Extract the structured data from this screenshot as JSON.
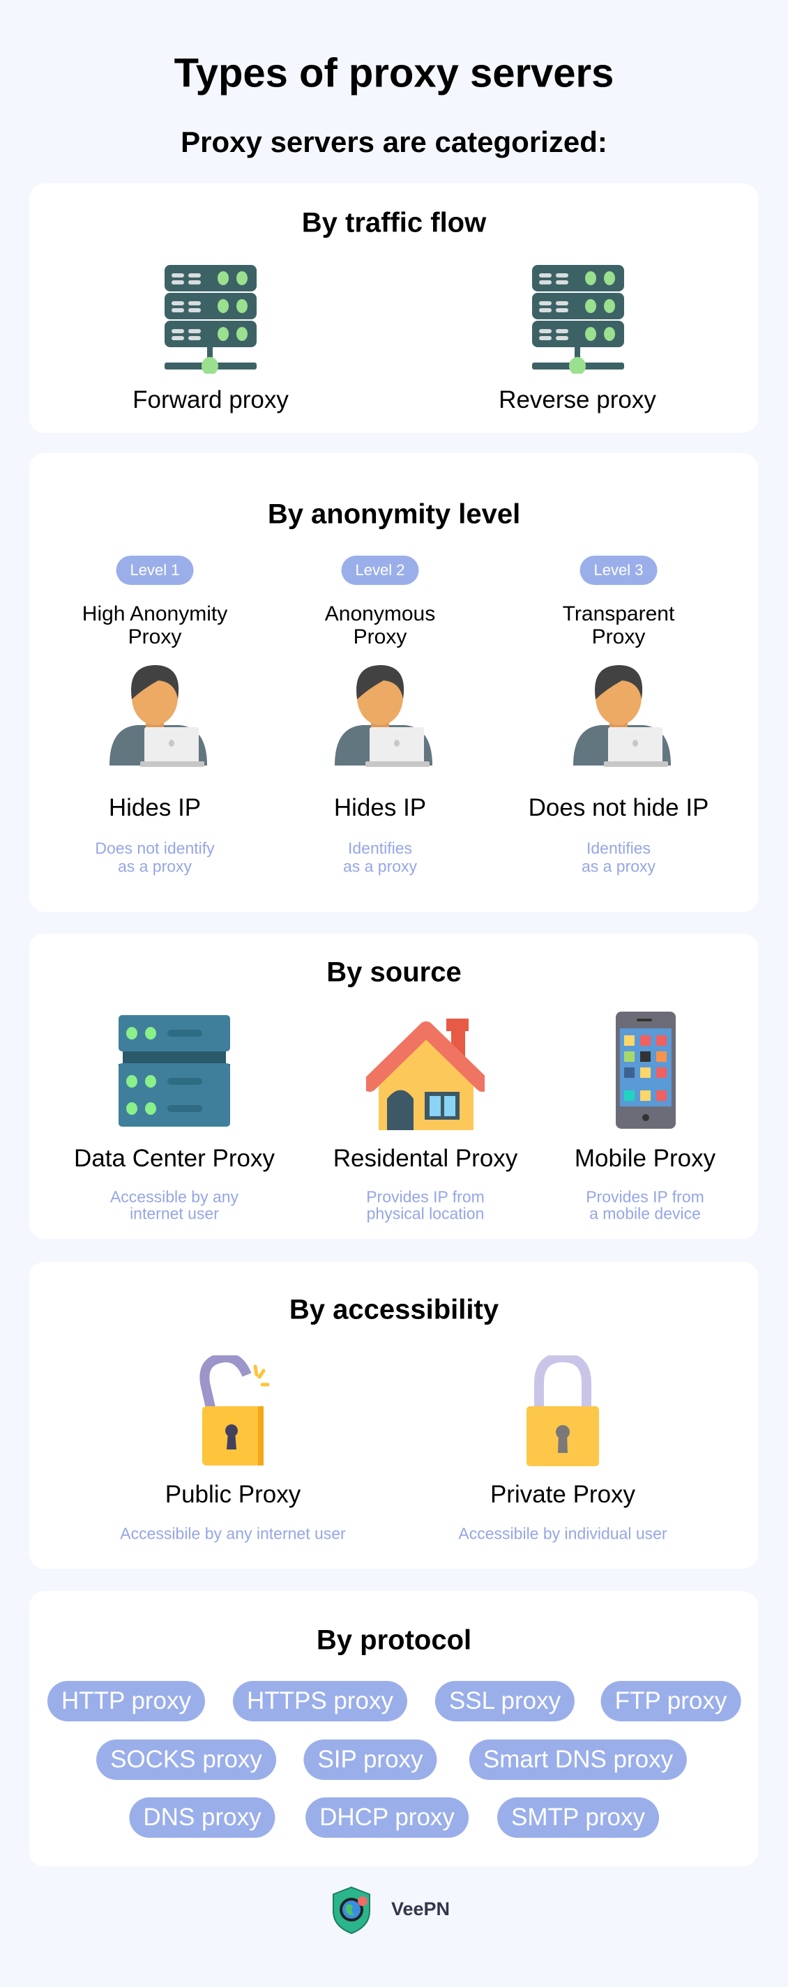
{
  "header": {
    "title": "Types of proxy servers",
    "subtitle": "Proxy servers are categorized:"
  },
  "traffic": {
    "title": "By traffic flow",
    "items": [
      {
        "label": "Forward proxy",
        "icon": "server-icon"
      },
      {
        "label": "Reverse proxy",
        "icon": "server-icon"
      }
    ]
  },
  "anonymity": {
    "title": "By anonymity level",
    "items": [
      {
        "level": "Level 1",
        "name1": "High Anonymity",
        "name2": "Proxy",
        "ip": "Hides IP",
        "desc1": "Does not identify",
        "desc2": "as a proxy"
      },
      {
        "level": "Level 2",
        "name1": "Anonymous",
        "name2": "Proxy",
        "ip": "Hides IP",
        "desc1": "Identifies",
        "desc2": "as a proxy"
      },
      {
        "level": "Level 3",
        "name1": "Transparent",
        "name2": "Proxy",
        "ip": "Does not hide IP",
        "desc1": "Identifies",
        "desc2": "as a proxy"
      }
    ]
  },
  "source": {
    "title": "By source",
    "items": [
      {
        "label": "Data Center Proxy",
        "desc1": "Accessible by any",
        "desc2": "internet user",
        "icon": "datacenter-icon"
      },
      {
        "label": "Residental Proxy",
        "desc1": "Provides IP from",
        "desc2": "physical location",
        "icon": "house-icon"
      },
      {
        "label": "Mobile Proxy",
        "desc1": "Provides IP from",
        "desc2": "a mobile device",
        "icon": "smartphone-icon"
      }
    ]
  },
  "access": {
    "title": "By accessibility",
    "items": [
      {
        "label": "Public Proxy",
        "desc": "Accessibile by any internet user",
        "icon": "unlocked-padlock-icon"
      },
      {
        "label": "Private Proxy",
        "desc": "Accessibile by individual user",
        "icon": "locked-padlock-icon"
      }
    ]
  },
  "protocol": {
    "title": "By protocol",
    "rows": [
      [
        "HTTP proxy",
        "HTTPS proxy",
        "SSL proxy",
        "FTP proxy"
      ],
      [
        "SOCKS proxy",
        "SIP proxy",
        "Smart DNS proxy"
      ],
      [
        "DNS proxy",
        "DHCP proxy",
        "SMTP proxy"
      ]
    ]
  },
  "footer": {
    "brand": "VeePN"
  },
  "colors": {
    "background": "#f4f7fd",
    "pill": "#9aaeea",
    "subtext": "#95a6e6",
    "server": "#3d6266",
    "accent_green": "#9be08f"
  }
}
